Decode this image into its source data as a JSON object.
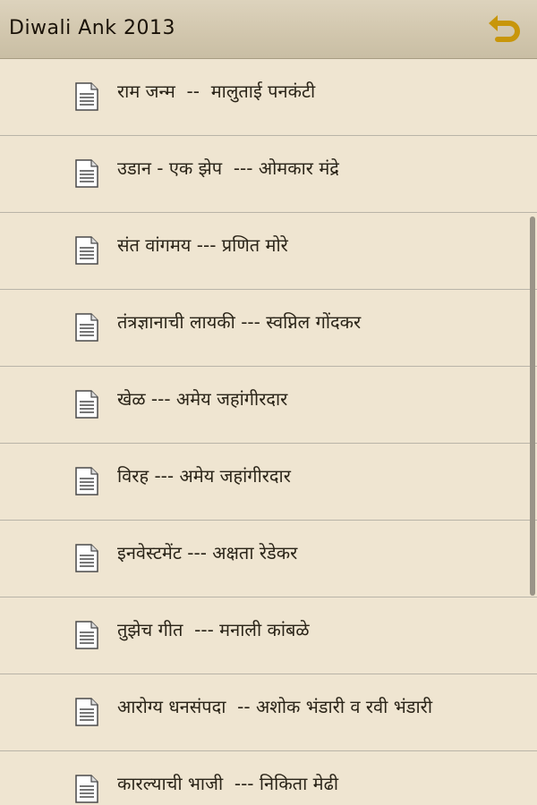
{
  "header": {
    "title": "Diwali Ank 2013",
    "back_icon": "back-arrow-icon"
  },
  "colors": {
    "background": "#efe5d1",
    "header": "#d2c7ae",
    "back_icon": "#c8960a",
    "divider": "#b9b4a8"
  },
  "list": {
    "items": [
      {
        "label": "राम जन्म  --  मालुताई पनकंटी"
      },
      {
        "label": "उडान - एक झेप  --- ओमकार मंद्रे"
      },
      {
        "label": "संत वांगमय --- प्रणित मोरे"
      },
      {
        "label": "तंत्रज्ञानाची लायकी --- स्वप्निल गोंदकर"
      },
      {
        "label": "खेळ --- अमेय जहांगीरदार"
      },
      {
        "label": "विरह --- अमेय जहांगीरदार"
      },
      {
        "label": "इनवेस्टमेंट --- अक्षता रेडेकर"
      },
      {
        "label": "तुझेच गीत  --- मनाली कांबळे"
      },
      {
        "label": "आरोग्य धनसंपदा  -- अशोक भंडारी व रवी भंडारी"
      },
      {
        "label": "कारल्याची भाजी  --- निकिता मेढी"
      }
    ]
  }
}
